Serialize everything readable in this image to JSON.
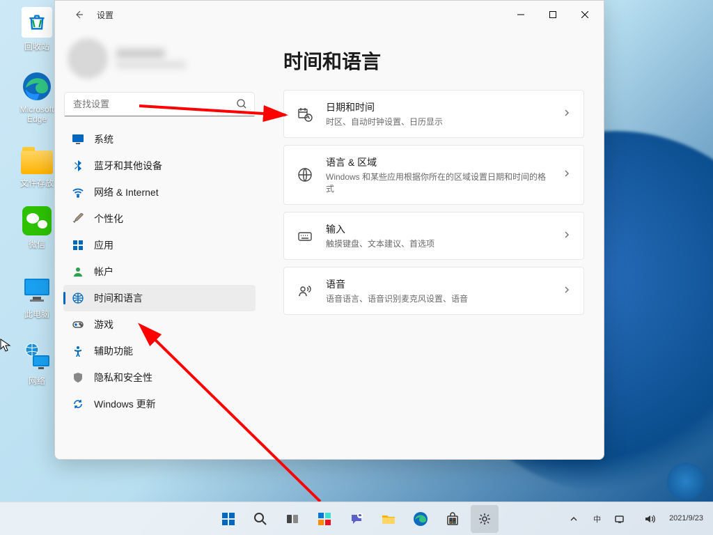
{
  "desktop": {
    "icons": [
      {
        "label": "回收站"
      },
      {
        "label": "Microsoft Edge"
      },
      {
        "label": "文件存放"
      },
      {
        "label": "微信"
      },
      {
        "label": "此电脑"
      },
      {
        "label": "网络"
      }
    ]
  },
  "window": {
    "title": "设置",
    "search_placeholder": "查找设置",
    "page_heading": "时间和语言"
  },
  "nav": [
    {
      "label": "系统"
    },
    {
      "label": "蓝牙和其他设备"
    },
    {
      "label": "网络 & Internet"
    },
    {
      "label": "个性化"
    },
    {
      "label": "应用"
    },
    {
      "label": "帐户"
    },
    {
      "label": "时间和语言"
    },
    {
      "label": "游戏"
    },
    {
      "label": "辅助功能"
    },
    {
      "label": "隐私和安全性"
    },
    {
      "label": "Windows 更新"
    }
  ],
  "cards": [
    {
      "title": "日期和时间",
      "sub": "时区、自动时钟设置、日历显示"
    },
    {
      "title": "语言 & 区域",
      "sub": "Windows 和某些应用根据你所在的区域设置日期和时间的格式"
    },
    {
      "title": "输入",
      "sub": "触摸键盘、文本建议、首选项"
    },
    {
      "title": "语音",
      "sub": "语音语言、语音识别麦克风设置、语音"
    }
  ],
  "tray": {
    "ime": "中",
    "date": "2021/9/23"
  }
}
